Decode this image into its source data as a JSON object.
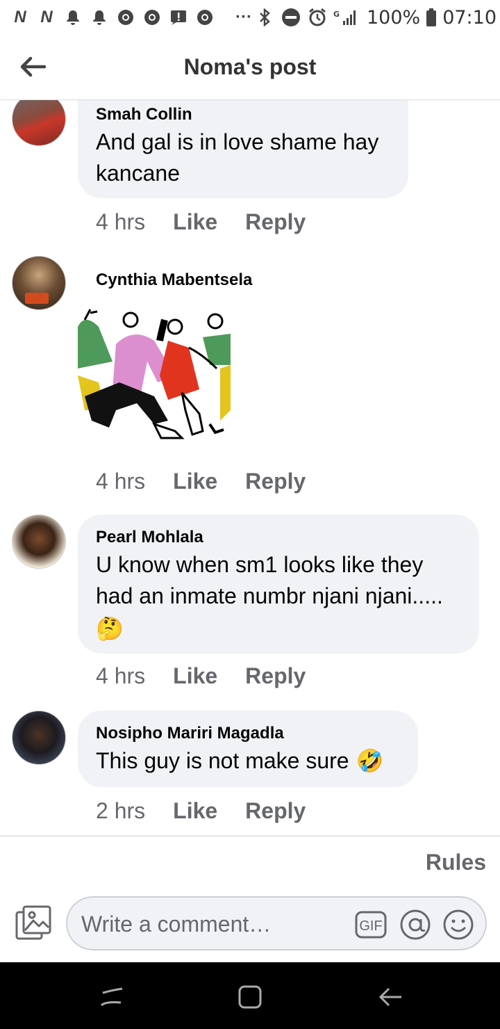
{
  "status_bar": {
    "left_icons": [
      "n-icon",
      "n-icon",
      "bell-icon",
      "bell-icon",
      "chrome-icon",
      "chrome-icon",
      "message-alert-icon",
      "chrome-icon",
      "ellipsis-icon"
    ],
    "battery": "100%",
    "time": "07:10"
  },
  "header": {
    "title": "Noma's post"
  },
  "comments": [
    {
      "author": "Smah Collin",
      "text": "And gal is in love shame hay kancane",
      "time": "4 hrs",
      "like": "Like",
      "reply": "Reply"
    },
    {
      "author": "Cynthia Mabentsela",
      "sticker": "dancing-people-sticker",
      "time": "4 hrs",
      "like": "Like",
      "reply": "Reply"
    },
    {
      "author": "Pearl Mohlala",
      "text": "U know when sm1 looks like they had an inmate numbr njani njani.....",
      "emoji": "🤔",
      "time": "4 hrs",
      "like": "Like",
      "reply": "Reply"
    },
    {
      "author": "Nosipho Mariri Magadla",
      "text": "This guy is not make sure",
      "emoji": "🤣",
      "time": "2 hrs",
      "like": "Like",
      "reply": "Reply"
    }
  ],
  "rules_label": "Rules",
  "composer": {
    "placeholder": "Write a comment…",
    "gif_label": "GIF"
  },
  "colors": {
    "bubble_bg": "#f0f2f5",
    "meta_text": "#65676b",
    "nav_bg": "#000000"
  }
}
